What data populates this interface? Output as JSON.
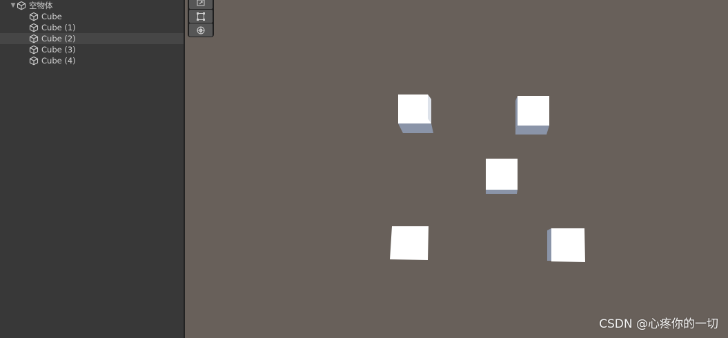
{
  "hierarchy": {
    "parent": {
      "label": "空物体",
      "expanded": true,
      "icon": "cube-outline-icon"
    },
    "children": [
      {
        "label": "Cube",
        "selected": false,
        "icon": "cube-outline-icon"
      },
      {
        "label": "Cube (1)",
        "selected": false,
        "icon": "cube-outline-icon"
      },
      {
        "label": "Cube (2)",
        "selected": true,
        "icon": "cube-outline-icon"
      },
      {
        "label": "Cube (3)",
        "selected": false,
        "icon": "cube-outline-icon"
      },
      {
        "label": "Cube (4)",
        "selected": false,
        "icon": "cube-outline-icon"
      }
    ]
  },
  "scene_view": {
    "background_color": "#68605a",
    "tools": [
      "scale-tool-icon",
      "rect-tool-icon",
      "transform-tool-icon"
    ],
    "cube_count": 5
  },
  "watermark": {
    "text": "CSDN @心疼你的一切"
  }
}
